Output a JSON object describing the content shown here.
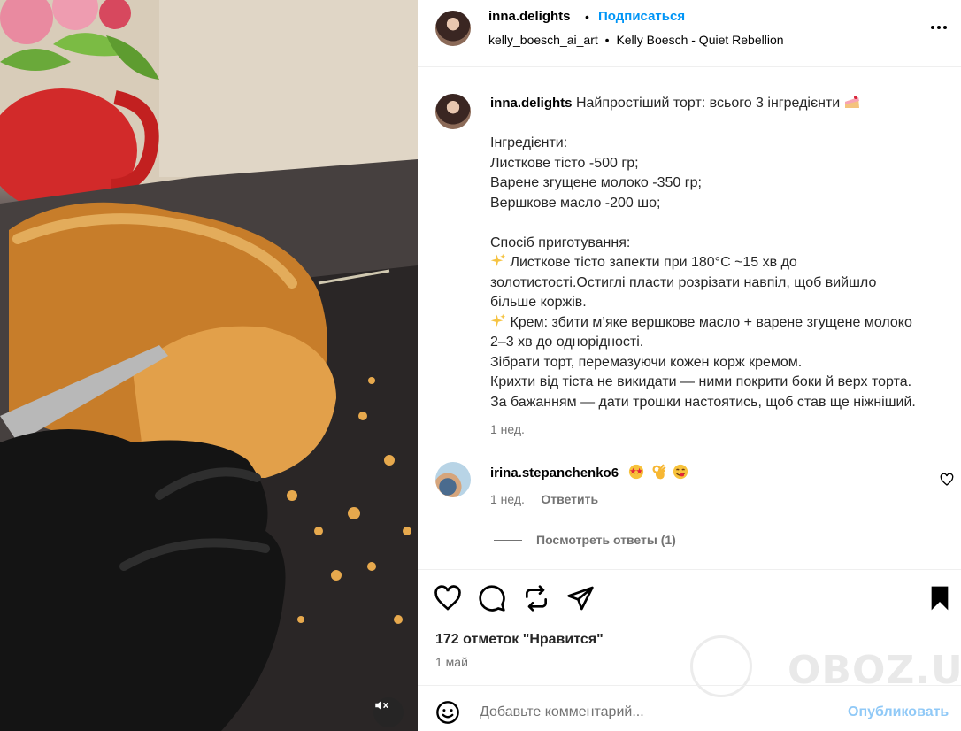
{
  "post": {
    "author": "inna.delights",
    "dot": "•",
    "follow_label": "Подписаться",
    "audio_handle": "kelly_boesch_ai_art",
    "audio_separator": "•",
    "audio_track": "Kelly Boesch - Quiet Rebellion"
  },
  "caption": {
    "author": "inna.delights",
    "title": "Найпростіший торт: всього 3 інгредієнти",
    "title_emoji_icon": "cake-icon",
    "lines": [
      "Інгредієнти:",
      "Листкове тісто -500 гр;",
      "Варене згущене молоко -350 гр;",
      "Вершкове масло -200 шо;",
      "",
      "Спосіб приготування:",
      "Листкове тісто запекти при 180°C ~15 хв до",
      "золотистості.Остиглі пласти розрізати навпіл, щоб вийшло",
      "більше коржів.",
      "Крем: збити м’яке вершкове масло + варене згущене молоко",
      "2–3 хв до однорідності.",
      "Зібрати торт, перемазуючи кожен корж кремом.",
      "Крихти від тіста не викидати — ними покрити боки й верх торта.",
      "За бажанням — дати трошки настоятись, щоб став ще ніжніший."
    ],
    "time": "1 нед."
  },
  "comment": {
    "author": "irina.stepanchenko6",
    "emojis": [
      "star-struck-icon",
      "ok-hand-icon",
      "yum-face-icon"
    ],
    "time": "1 нед.",
    "reply_label": "Ответить",
    "view_replies_label": "Посмотреть ответы (1)"
  },
  "actions": {
    "likes": "172 отметок \"Нравится\"",
    "date": "1 май"
  },
  "comment_bar": {
    "placeholder": "Добавьте комментарий...",
    "publish_label": "Опубликовать"
  },
  "watermark": {
    "text": "OBOZ.UA"
  },
  "colors": {
    "accent": "#0095f6",
    "publish_disabled": "#90c9f7",
    "muted": "#737373"
  }
}
